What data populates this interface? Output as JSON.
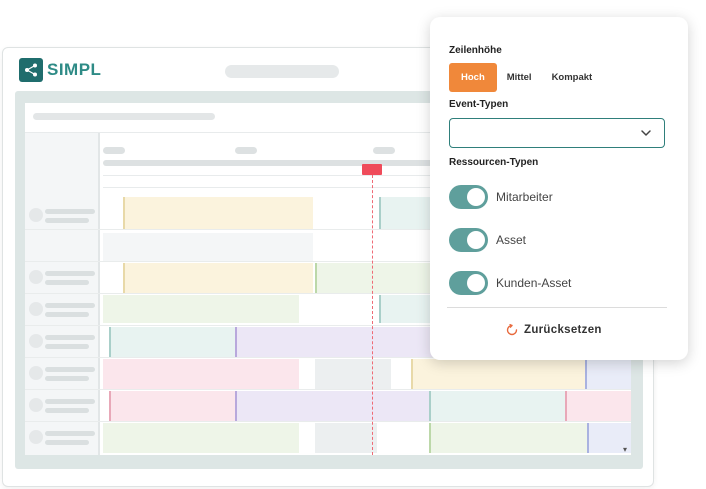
{
  "app": {
    "logo_text": "SIMPL",
    "logo_icon": "share-network-icon",
    "brand_color": "#2e8b86"
  },
  "panel": {
    "row_height": {
      "title": "Zeilenhöhe",
      "options": [
        {
          "label": "Hoch",
          "active": true
        },
        {
          "label": "Mittel",
          "active": false
        },
        {
          "label": "Kompakt",
          "active": false
        }
      ],
      "active_color": "#f0883a"
    },
    "event_types": {
      "title": "Event-Typen",
      "value": "",
      "icon": "chevron-down-icon"
    },
    "resource_types": {
      "title": "Ressourcen-Typen",
      "items": [
        {
          "label": "Mitarbeiter",
          "on": true
        },
        {
          "label": "Asset",
          "on": true
        },
        {
          "label": "Kunden-Asset",
          "on": true
        }
      ],
      "toggle_color": "#5f9f9c"
    },
    "reset": {
      "label": "Zurücksetzen",
      "icon": "reset-icon",
      "icon_color": "#e8693c"
    }
  },
  "colors": {
    "yellow": "#fbf3dd",
    "green": "#eef5e8",
    "teal": "#e8f3f1",
    "purple": "#ece7f6",
    "pink": "#fbe6ec",
    "gray": "#eceff0",
    "blue": "#e9ecf8",
    "now": "#ef4b5a"
  }
}
